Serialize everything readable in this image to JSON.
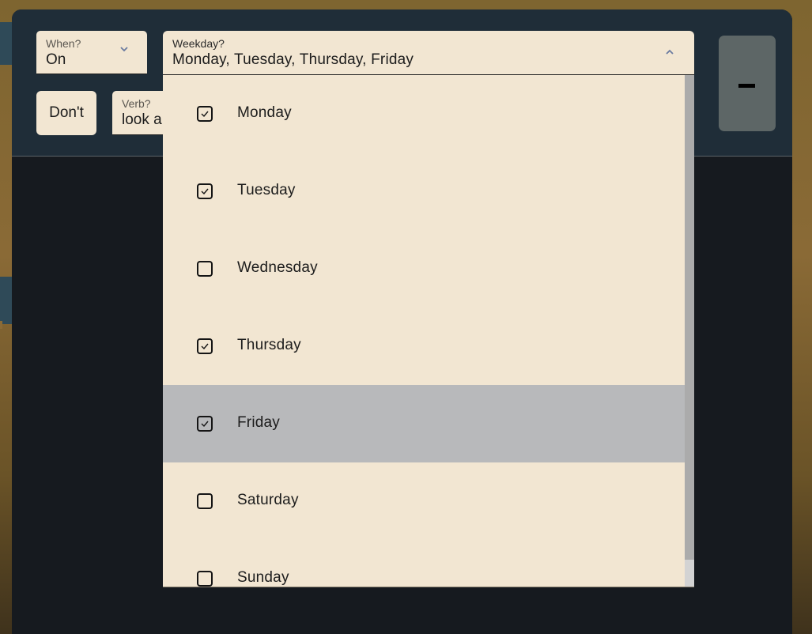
{
  "when": {
    "label": "When?",
    "value": "On",
    "icon": "chevron-down-icon"
  },
  "dont_button": {
    "label": "Don't"
  },
  "verb": {
    "label": "Verb?",
    "value": "look a"
  },
  "weekday": {
    "label": "Weekday?",
    "value": "Monday,  Tuesday,  Thursday,  Friday",
    "icon": "chevron-up-icon",
    "expanded": true,
    "options": [
      {
        "label": "Monday",
        "checked": true,
        "highlighted": false
      },
      {
        "label": "Tuesday",
        "checked": true,
        "highlighted": false
      },
      {
        "label": "Wednesday",
        "checked": false,
        "highlighted": false
      },
      {
        "label": "Thursday",
        "checked": true,
        "highlighted": false
      },
      {
        "label": "Friday",
        "checked": true,
        "highlighted": true
      },
      {
        "label": "Saturday",
        "checked": false,
        "highlighted": false
      },
      {
        "label": "Sunday",
        "checked": false,
        "highlighted": false
      }
    ]
  },
  "remove_button": {
    "icon": "minus-icon"
  },
  "colors": {
    "field_bg": "#f2e6d2",
    "header_bg": "#1f2d38",
    "panel_bg": "#161a1f",
    "highlight_bg": "#b8b9bb",
    "remove_button_bg": "#5d6666",
    "chevron": "#6a7aa0"
  }
}
